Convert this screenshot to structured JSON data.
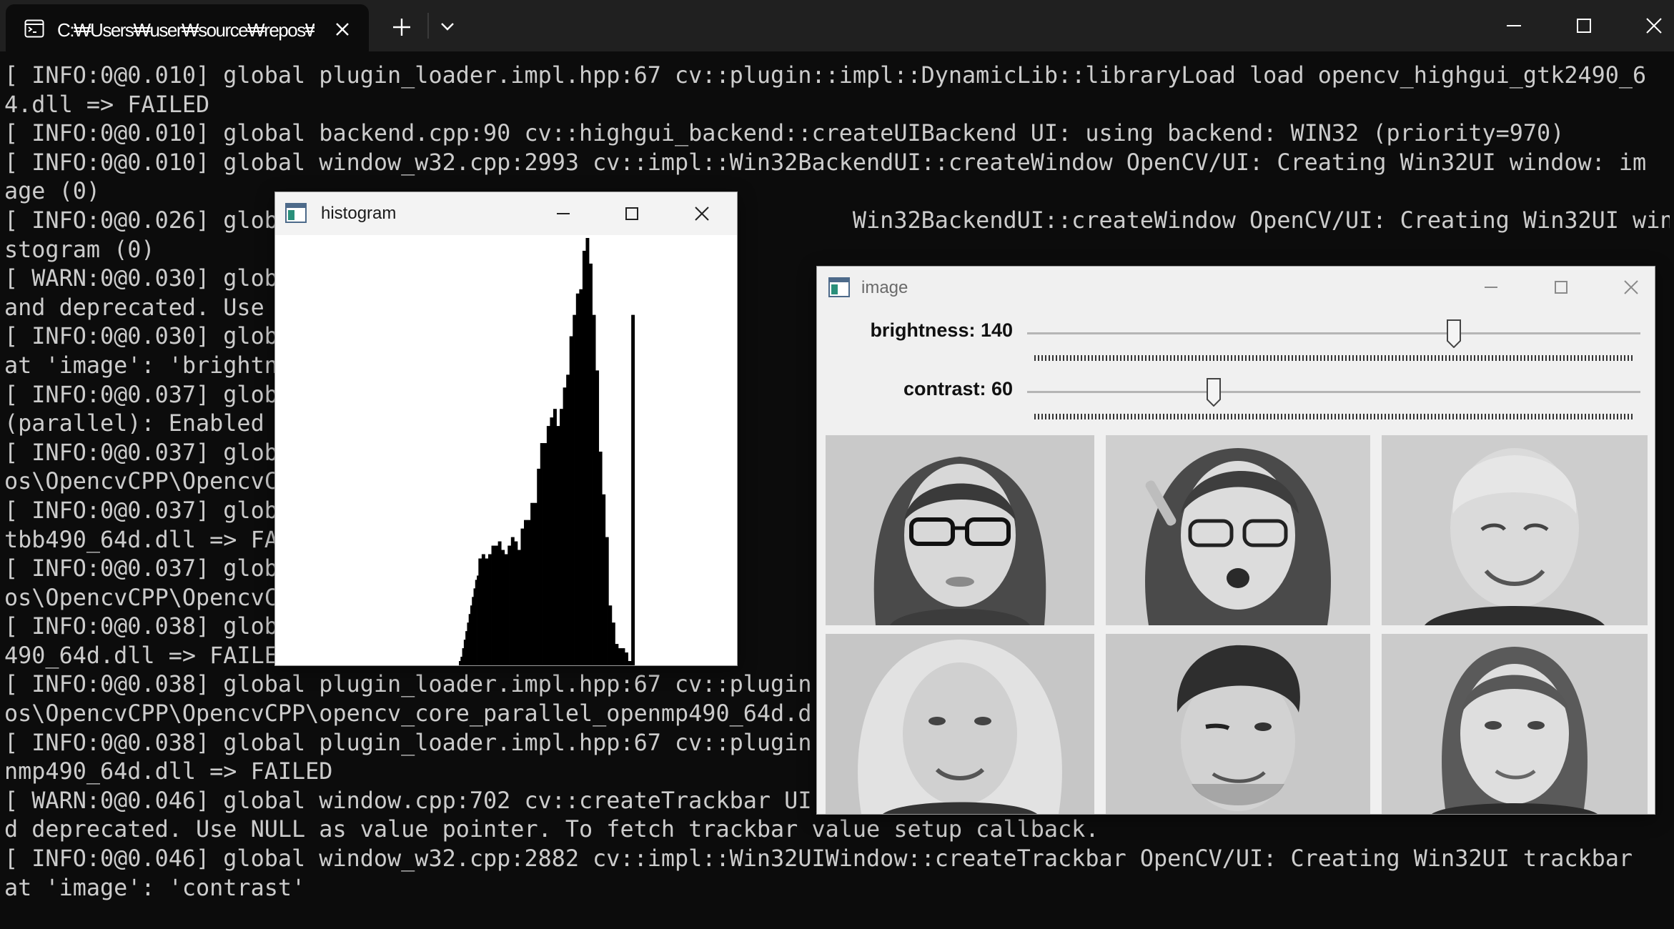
{
  "terminal": {
    "tab_title": "C:₩Users₩user₩source₩repos₩OpencvCPP",
    "lines": [
      "[ INFO:0@0.010] global plugin_loader.impl.hpp:67 cv::plugin::impl::DynamicLib::libraryLoad load opencv_highgui_gtk2490_6",
      "4.dll => FAILED",
      "[ INFO:0@0.010] global backend.cpp:90 cv::highgui_backend::createUIBackend UI: using backend: WIN32 (priority=970)",
      "[ INFO:0@0.010] global window_w32.cpp:2993 cv::impl::Win32BackendUI::createWindow OpenCV/UI: Creating Win32UI window: im",
      "age (0)",
      "[ INFO:0@0.026] glob                                          Win32BackendUI::createWindow OpenCV/UI: Creating Win32UI window: hi",
      "stogram (0)",
      "[ WARN:0@0.030] glob                                          bar UI",
      "and deprecated. Use                                           rackba",
      "[ INFO:0@0.030] glob                                          Win32U",
      "at 'image': 'brightn",
      "[ INFO:0@0.037] glob                                          cv::pa",
      "(parallel): Enabled                                           ONETBB",
      "[ INFO:0@0.037] glob                                          plugin",
      "os\\OpencvCPP\\OpencvC                                          _64d.d",
      "[ INFO:0@0.037] glob                                          plugin",
      "tbb490_64d.dll => FA",
      "[ INFO:0@0.037] glob                                          plugin",
      "os\\OpencvCPP\\OpencvC                                          d.dll",
      "[ INFO:0@0.038] glob                                          plugin",
      "490_64d.dll => FAILE",
      "[ INFO:0@0.038] global plugin_loader.impl.hpp:67 cv::plugin",
      "os\\OpencvCPP\\OpencvCPP\\opencv_core_parallel_openmp490_64d.d",
      "[ INFO:0@0.038] global plugin_loader.impl.hpp:67 cv::plugin",
      "nmp490_64d.dll => FAILED",
      "[ WARN:0@0.046] global window.cpp:702 cv::createTrackbar UI,",
      "d deprecated. Use NULL as value pointer. To fetch trackbar value setup callback.",
      "[ INFO:0@0.046] global window_w32.cpp:2882 cv::impl::Win32UIWindow::createTrackbar OpenCV/UI: Creating Win32UI trackbar",
      "at 'image': 'contrast'"
    ]
  },
  "histogram_window": {
    "title": "histogram",
    "chart_data": {
      "type": "bar",
      "title": "",
      "bar_color": "#000000",
      "background": "#ffffff",
      "ylim": [
        0,
        100
      ],
      "values": [
        0,
        0,
        0,
        0,
        0,
        0,
        0,
        0,
        0,
        0,
        0,
        0,
        0,
        0,
        0,
        0,
        0,
        0,
        0,
        0,
        0,
        0,
        0,
        0,
        0,
        0,
        0,
        0,
        0,
        0,
        0,
        0,
        0,
        0,
        0,
        0,
        0,
        0,
        0,
        0,
        0,
        0,
        0,
        0,
        0,
        0,
        0,
        0,
        0,
        0,
        0,
        0,
        0,
        0,
        0,
        0,
        0,
        0,
        0,
        0,
        0,
        0,
        0,
        0,
        0,
        0,
        0,
        0,
        0,
        0,
        0,
        0,
        0,
        0,
        0,
        0,
        0,
        0,
        0,
        0,
        0,
        0,
        0,
        0,
        0,
        0,
        0,
        0,
        0,
        0,
        0,
        0,
        0,
        0,
        0,
        0,
        0,
        0,
        0,
        0,
        0,
        0,
        0,
        0,
        0,
        0,
        0,
        0,
        0,
        0,
        0,
        0,
        0,
        1,
        2,
        4,
        6,
        8,
        10,
        12,
        14,
        16,
        18,
        20,
        21,
        25,
        25,
        26,
        26,
        25,
        25,
        26,
        26,
        28,
        28,
        28,
        28,
        29,
        29,
        27,
        27,
        26,
        26,
        28,
        28,
        30,
        30,
        29,
        29,
        27,
        27,
        32,
        32,
        34,
        34,
        34,
        34,
        38,
        38,
        38,
        38,
        46,
        46,
        52,
        52,
        52,
        52,
        56,
        56,
        58,
        58,
        60,
        60,
        56,
        56,
        60,
        60,
        65,
        65,
        68,
        68,
        77,
        77,
        82,
        82,
        87,
        87,
        88,
        88,
        97,
        97,
        100,
        100,
        94,
        94,
        82,
        82,
        69,
        69,
        50,
        50,
        40,
        40,
        30,
        30,
        14,
        14,
        10,
        10,
        5,
        5,
        4,
        4,
        4,
        4,
        3,
        3,
        1,
        1,
        82,
        82,
        0,
        0,
        0,
        0,
        0,
        0,
        0,
        0,
        0,
        0,
        0,
        0,
        0,
        0,
        0,
        0,
        0,
        0,
        0,
        0,
        0,
        0,
        0,
        0,
        0,
        0,
        0,
        0,
        0,
        0,
        0,
        0,
        0,
        0,
        0,
        0,
        0,
        0,
        0,
        0,
        0,
        0,
        0,
        0,
        0,
        0,
        0,
        0,
        0,
        0,
        0,
        0,
        0,
        0,
        0,
        0,
        0,
        0,
        0,
        0,
        0,
        0,
        0
      ]
    }
  },
  "image_window": {
    "title": "image",
    "trackbars": [
      {
        "label": "brightness: 140",
        "value": 140,
        "max": 200
      },
      {
        "label": "contrast: 60",
        "value": 60,
        "max": 200
      }
    ],
    "photos": [
      {
        "name": "woman-with-glasses"
      },
      {
        "name": "surprised-woman-with-glasses"
      },
      {
        "name": "smiling-old-man"
      },
      {
        "name": "smiling-blonde-woman"
      },
      {
        "name": "winking-young-man"
      },
      {
        "name": "smiling-young-woman"
      }
    ]
  }
}
